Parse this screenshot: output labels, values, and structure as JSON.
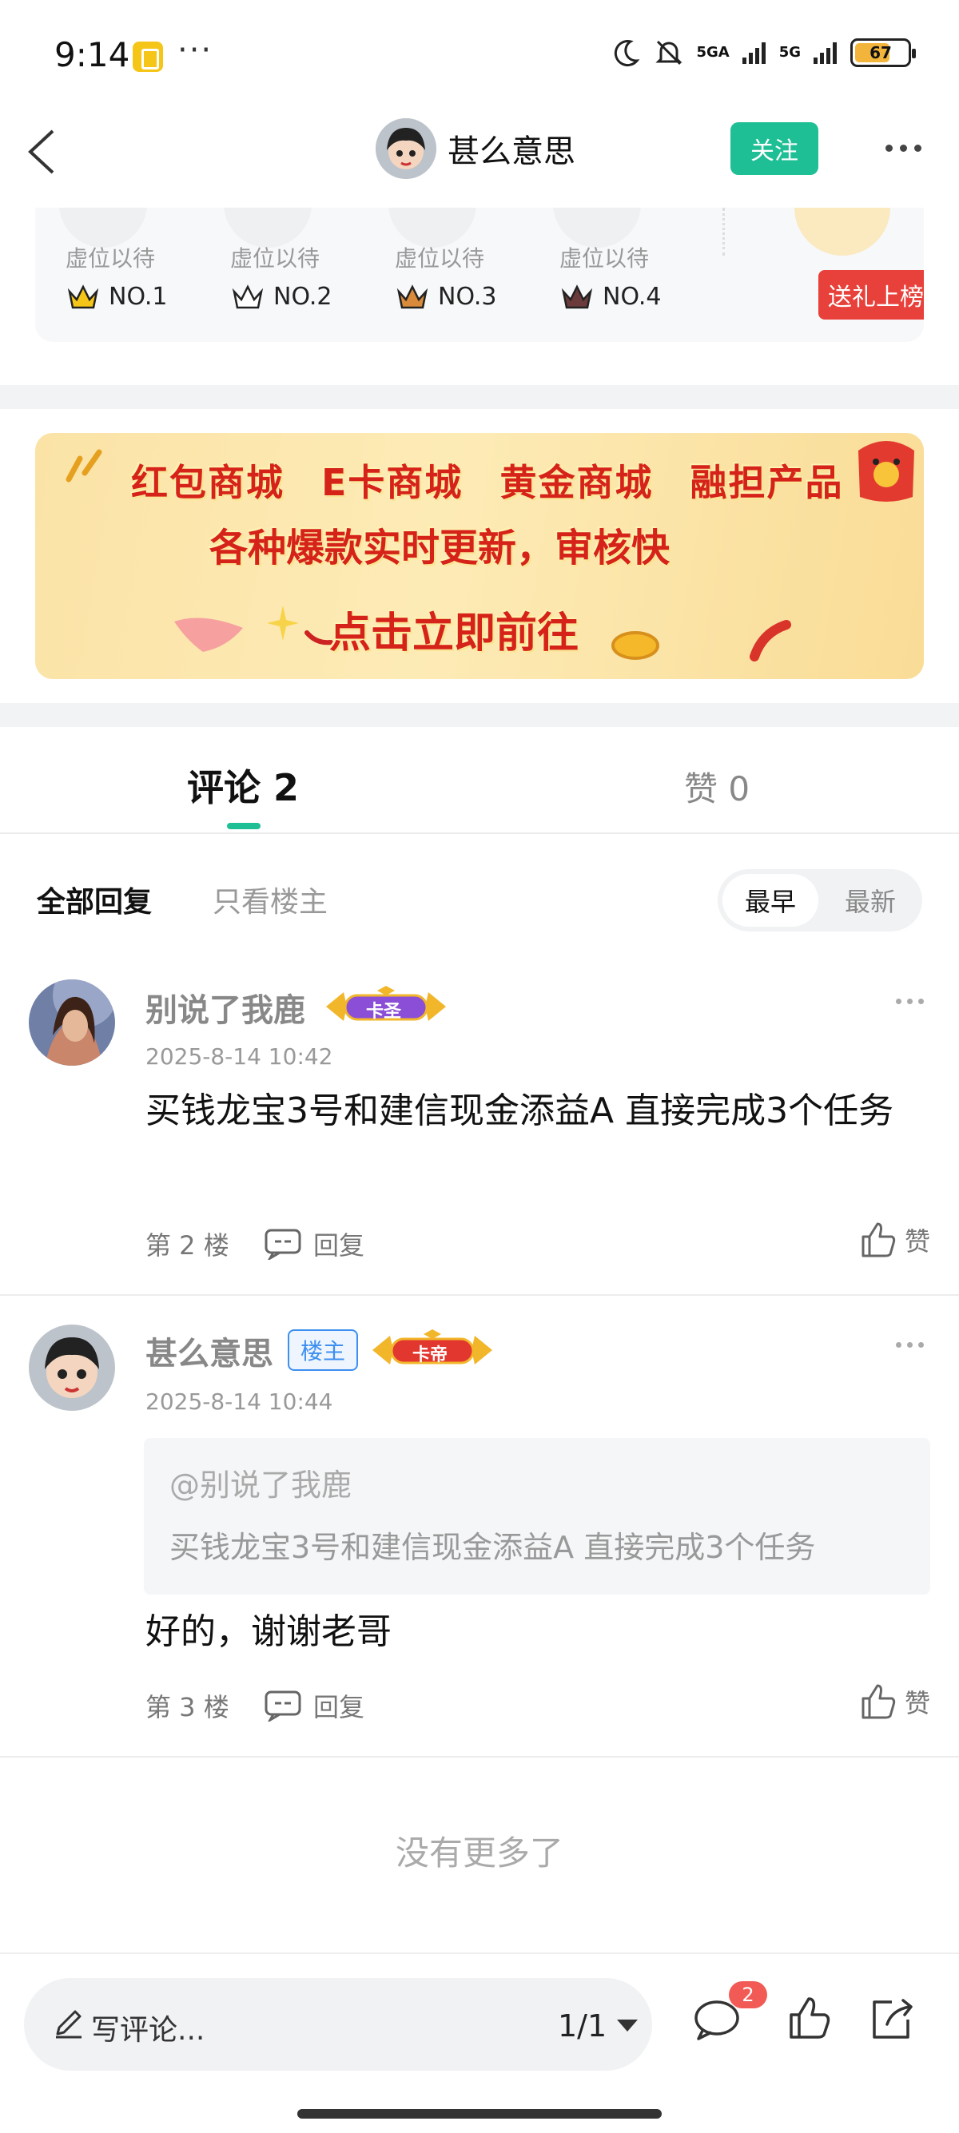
{
  "status_bar": {
    "time": "9:14",
    "network1": "5GA",
    "network2": "5G",
    "battery": "67",
    "battery_level": 0.67
  },
  "header": {
    "username": "甚么意思",
    "follow_label": "关注"
  },
  "ranking": {
    "slots": [
      {
        "placeholder": "虚位以待",
        "rank": "NO.1",
        "crown_color": "#f5c518"
      },
      {
        "placeholder": "虚位以待",
        "rank": "NO.2",
        "crown_color": "#ffffff"
      },
      {
        "placeholder": "虚位以待",
        "rank": "NO.3",
        "crown_color": "#d98a3a"
      },
      {
        "placeholder": "虚位以待",
        "rank": "NO.4",
        "crown_color": "#6b3b3b"
      }
    ],
    "gift_button": "送礼上榜"
  },
  "banner": {
    "items": [
      "红包商城",
      "E卡商城",
      "黄金商城",
      "融担产品"
    ],
    "subtitle": "各种爆款实时更新，审核快",
    "cta": "点击立即前往"
  },
  "tabs": {
    "comments": "评论 2",
    "likes": "赞 0"
  },
  "filter": {
    "all": "全部回复",
    "owner_only": "只看楼主",
    "earliest": "最早",
    "latest": "最新"
  },
  "comments": [
    {
      "name": "别说了我鹿",
      "title_badge": "卡圣",
      "time": "2025-8-14 10:42",
      "text": "买钱龙宝3号和建信现金添益A 直接完成3个任务",
      "floor": "第 2 楼",
      "reply": "回复",
      "like": "赞"
    },
    {
      "name": "甚么意思",
      "owner_badge": "楼主",
      "title_badge": "卡帝",
      "time": "2025-8-14 10:44",
      "quote_at": "@别说了我鹿",
      "quote_text": "买钱龙宝3号和建信现金添益A 直接完成3个任务",
      "text": "好的，谢谢老哥",
      "floor": "第 3 楼",
      "reply": "回复",
      "like": "赞"
    }
  ],
  "end_note": "没有更多了",
  "bottom_bar": {
    "write_placeholder": "写评论...",
    "page_indicator": "1/1",
    "comment_count": "2"
  },
  "colors": {
    "accent": "#1fbf95",
    "gift_red": "#e8403a",
    "badge_blue": "#3d8ff0"
  }
}
